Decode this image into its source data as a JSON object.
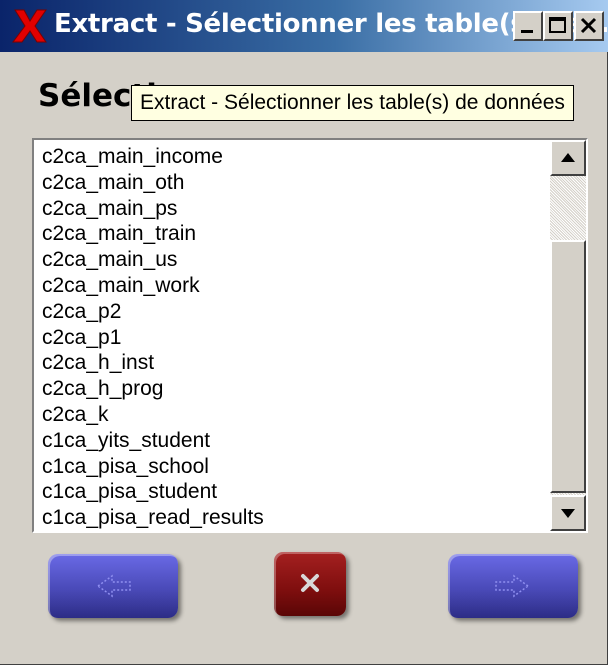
{
  "window": {
    "title": "Extract - Sélectionner les table(s) de ...",
    "icon": "red-x-icon",
    "controls": [
      "minimize-icon",
      "maximize-icon",
      "close-icon"
    ]
  },
  "heading": "Sélecti",
  "tooltip": "Extract - Sélectionner les table(s) de données",
  "list": {
    "items": [
      "c2ca_main_income",
      "c2ca_main_oth",
      "c2ca_main_ps",
      "c2ca_main_train",
      "c2ca_main_us",
      "c2ca_main_work",
      "c2ca_p2",
      "c2ca_p1",
      "c2ca_h_inst",
      "c2ca_h_prog",
      "c2ca_k",
      "c1ca_yits_student",
      "c1ca_pisa_school",
      "c1ca_pisa_student",
      "c1ca_pisa_read_results"
    ]
  },
  "buttons": {
    "back_icon": "arrow-left-icon",
    "cancel_icon": "close-icon",
    "next_icon": "arrow-right-icon"
  },
  "colors": {
    "face": "#d4d0c8",
    "titlebar": "#0a246a",
    "tooltip_bg": "#ffffe1",
    "nav_button": "#4a4ab8",
    "cancel_button": "#7e0e0e"
  }
}
